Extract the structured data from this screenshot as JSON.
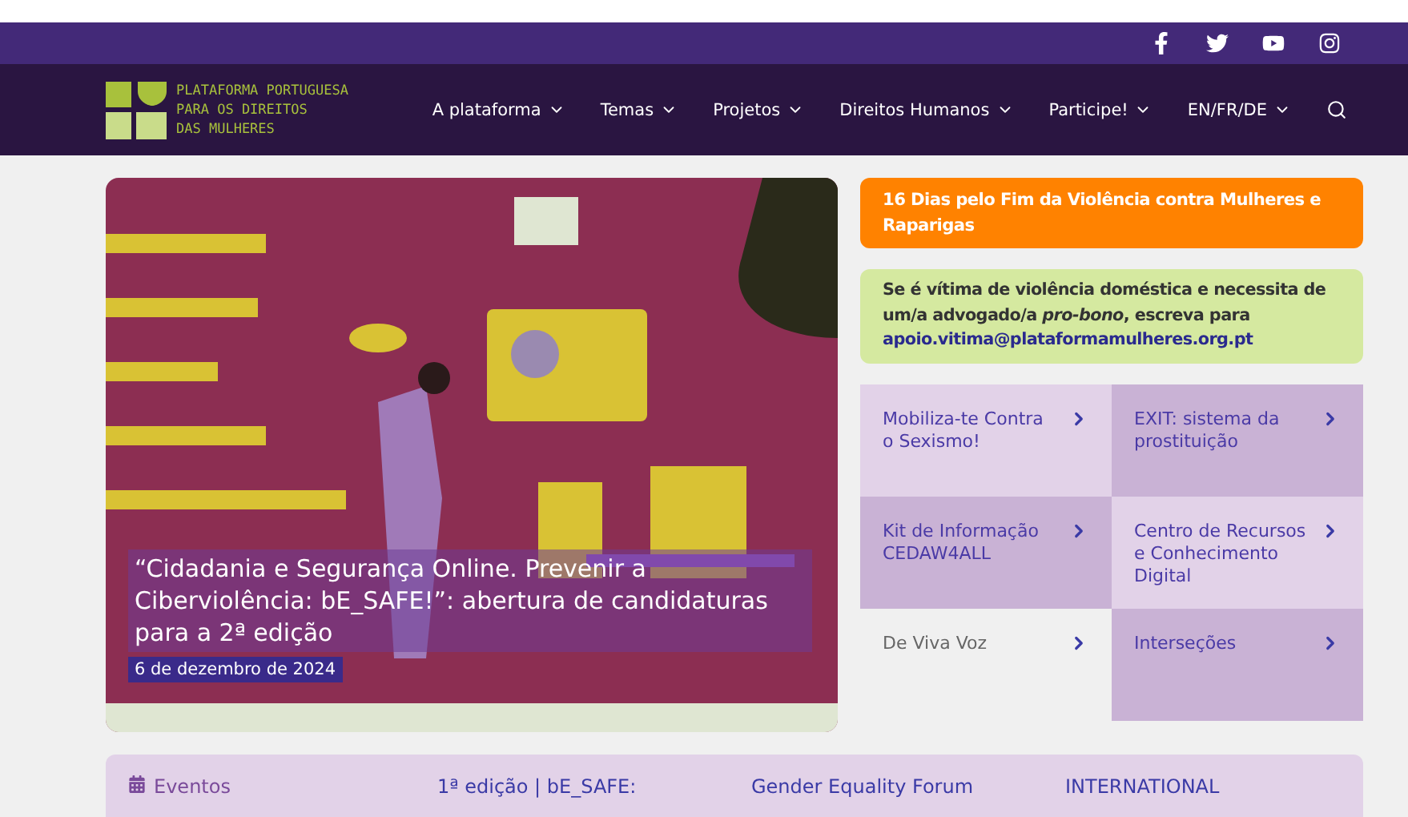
{
  "social": [
    {
      "kind": "facebook"
    },
    {
      "kind": "twitter"
    },
    {
      "kind": "youtube"
    },
    {
      "kind": "instagram"
    }
  ],
  "logo": {
    "lines": [
      "PLATAFORMA PORTUGUESA",
      "PARA OS DIREITOS",
      "DAS MULHERES"
    ]
  },
  "nav": [
    "A plataforma",
    "Temas",
    "Projetos",
    "Direitos Humanos",
    "Participe!",
    "EN/FR/DE"
  ],
  "feature": {
    "kind": "picture",
    "caption": "“Cidadania e Segurança Online. Prevenir a Ciberviolência: bE_SAFE!”: abertura de candidaturas para a 2ª edição",
    "date": "6 de dezembro de 2024"
  },
  "campaign": "16 Dias pelo Fim da Violência contra Mulheres e Raparigas",
  "notice": {
    "text": "Se é vítima de violência doméstica e necessita de um/a advogado/a *pro-bono*, escreva para",
    "email": "apoio.vitima@plataformamulheres.org.pt"
  },
  "tiles": [
    {
      "label": "Mobiliza-te Contra o Sexismo!",
      "color": "#e2d2e8"
    },
    {
      "label": "EXIT: sistema da prostituição",
      "color": "#c9b2d5"
    },
    {
      "label": "Kit de Informação CEDAW4ALL",
      "color": "#c9b2d5"
    },
    {
      "label": "Centro de Recursos e Conhecimento Digital",
      "color": "#e2d2e8"
    },
    {
      "label": "De Viva Voz",
      "color": "#f0f0f0"
    },
    {
      "label": "Interseções",
      "color": "#c9b2d5"
    }
  ],
  "events": {
    "title": "Eventos",
    "items": [
      "1ª edição | bE_SAFE:",
      "Gender Equality Forum",
      "INTERNATIONAL"
    ]
  }
}
